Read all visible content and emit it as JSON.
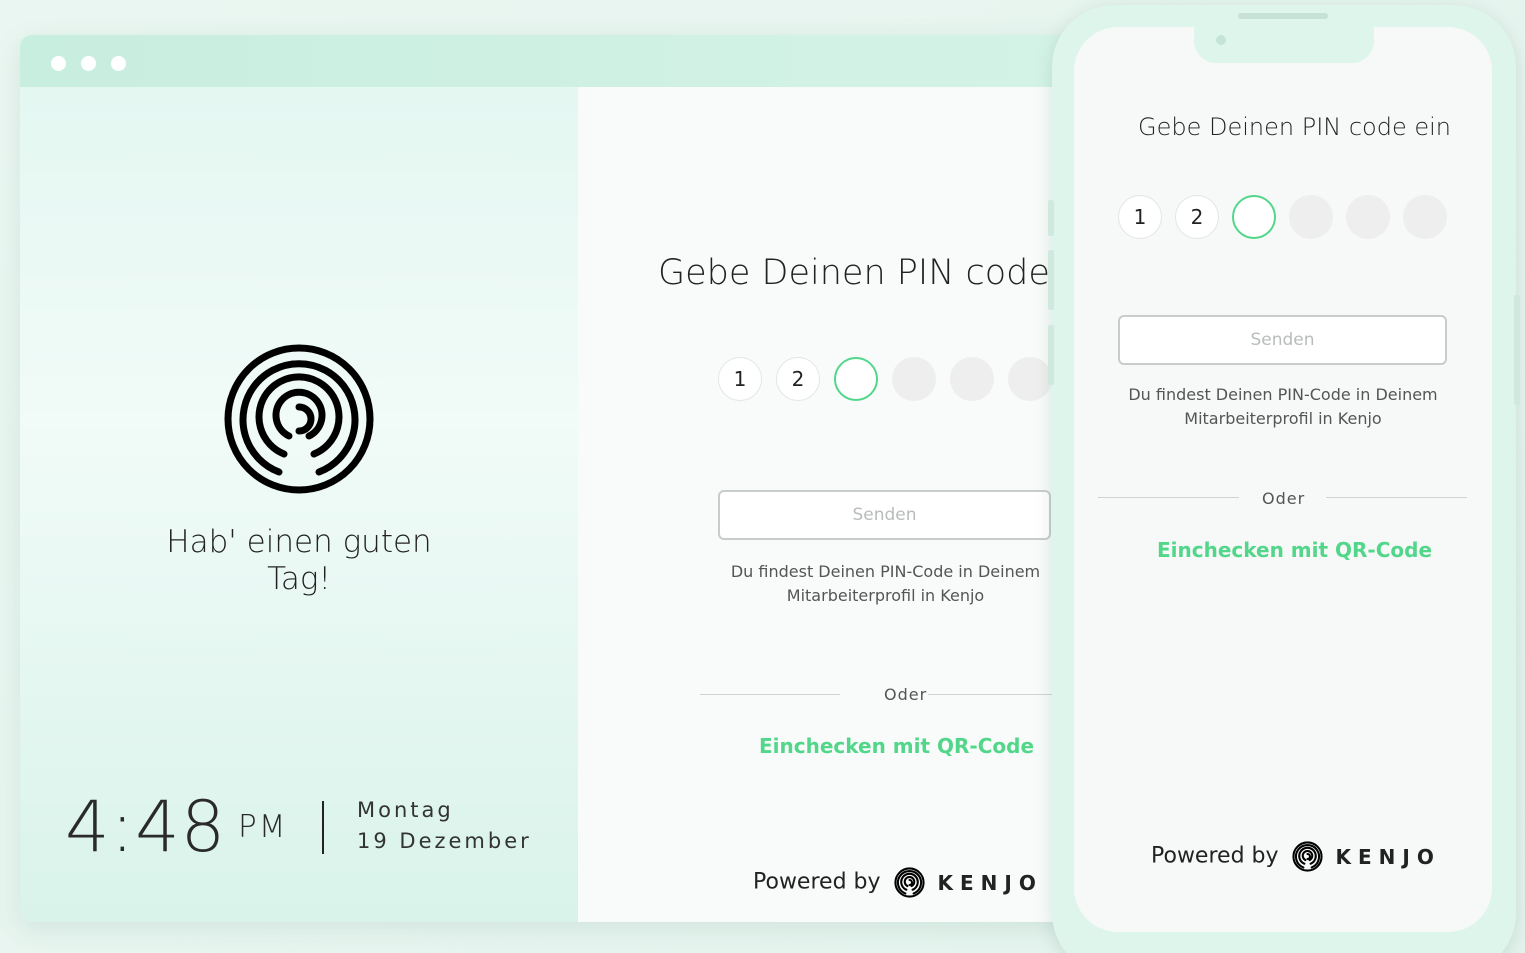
{
  "left": {
    "greeting": "Hab' einen guten Tag!",
    "time": "4:48",
    "ampm": "PM",
    "day": "Montag",
    "date": "19 Dezember"
  },
  "kiosk": {
    "title": "Gebe Deinen PIN code",
    "digits": [
      "1",
      "2",
      "",
      "",
      "",
      ""
    ],
    "send_label": "Senden",
    "hint": "Du findest Deinen PIN-Code in Deinem Mitarbeiterprofil in Kenjo",
    "or_label": "Oder",
    "qr_label": "Einchecken mit QR-Code",
    "powered_label": "Powered by",
    "brand": "KENJO"
  },
  "phone": {
    "title": "Gebe Deinen PIN code ein",
    "digits": [
      "1",
      "2",
      "",
      "",
      "",
      ""
    ],
    "send_label": "Senden",
    "hint": "Du findest Deinen PIN-Code in Deinem Mitarbeiterprofil in Kenjo",
    "or_label": "Oder",
    "qr_label": "Einchecken mit QR-Code",
    "powered_label": "Powered by",
    "brand": "KENJO"
  },
  "colors": {
    "accent_green": "#52d68a",
    "mint_background": "#def5ec"
  },
  "icons": {
    "brand_logo": "kenjo-maze-logo-icon"
  }
}
